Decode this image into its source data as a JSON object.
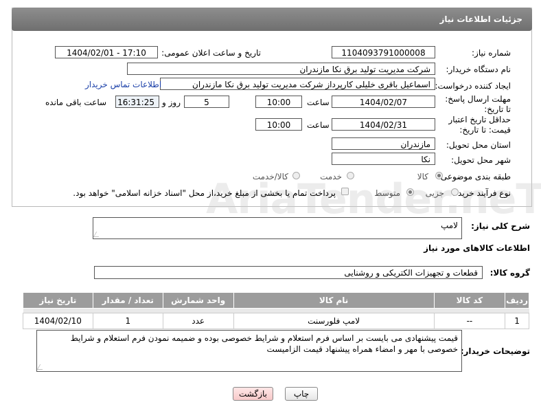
{
  "header": {
    "title": "جزئیات اطلاعات نیاز"
  },
  "fields": {
    "need_number_label": "شماره نیاز:",
    "need_number": "1104093791000008",
    "announce_label": "تاریخ و ساعت اعلان عمومی:",
    "announce_value": "1404/02/01 - 17:10",
    "buyer_org_label": "نام دستگاه خریدار:",
    "buyer_org": "شرکت مدیریت تولید برق نکا  مازندران",
    "creator_label": "ایجاد کننده درخواست:",
    "creator": "اسماعیل باقری خلیلی کارپرداز شرکت مدیریت تولید برق نکا  مازندران",
    "contact_link": "اطلاعات تماس خریدار",
    "deadline_label": "مهلت ارسال پاسخ: تا تاریخ:",
    "deadline_date": "1404/02/07",
    "time_label": "ساعت",
    "deadline_time": "10:00",
    "days_value": "5",
    "days_label": "روز و",
    "remaining_time": "16:31:25",
    "remaining_label": "ساعت باقی مانده",
    "validity_label": "حداقل تاریخ اعتبار قیمت: تا تاریخ:",
    "validity_date": "1404/02/31",
    "validity_time": "10:00",
    "province_label": "استان محل تحویل:",
    "province": "مازندران",
    "city_label": "شهر محل تحویل:",
    "city": "نکا",
    "category_label": "طبقه بندی موضوعی:",
    "category_options": [
      "کالا",
      "خدمت",
      "کالا/خدمت"
    ],
    "process_label": "نوع فرآیند خرید :",
    "process_options": [
      "جزیی",
      "متوسط"
    ],
    "payment_note": "پرداخت تمام یا بخشی از مبلغ خرید،از محل \"اسناد خزانه اسلامی\" خواهد بود."
  },
  "description": {
    "label": "شرح کلی نیاز:",
    "value": "لامپ"
  },
  "goods": {
    "section_title": "اطلاعات کالاهای مورد نیاز",
    "group_label": "گروه کالا:",
    "group_value": "قطعات و تجهیزات الکتریکی و روشنایی",
    "columns": [
      "ردیف",
      "کد کالا",
      "نام کالا",
      "واحد شمارش",
      "تعداد / مقدار",
      "تاریخ نیاز"
    ],
    "rows": [
      [
        "1",
        "--",
        "لامپ فلورسنت",
        "عدد",
        "1",
        "1404/02/10"
      ]
    ]
  },
  "buyer_notes": {
    "label": "توضیحات خریدار:",
    "value": "قیمت پیشنهادی می بایست بر اساس فرم استعلام و شرایط خصوصی بوده و ضمیمه نمودن فرم استعلام و شرایط خصوصی با مهر و امضاء همراه پیشنهاد قیمت الزامیست"
  },
  "buttons": {
    "print": "چاپ",
    "back": "بازگشت"
  },
  "watermark": "AriaTender.neT"
}
